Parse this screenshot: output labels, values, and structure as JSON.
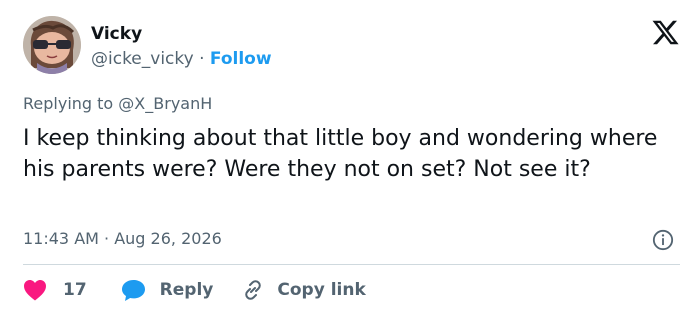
{
  "author": {
    "display_name": "Vicky",
    "handle": "@icke_vicky",
    "separator": " · ",
    "follow_label": "Follow",
    "avatar_icon": "avatar-cartoon-girl"
  },
  "platform_icon": "x-logo-icon",
  "reply_context": {
    "prefix": "Replying to ",
    "target": "@X_BryanH"
  },
  "tweet": {
    "text": "I keep thinking about that little boy and wondering where his parents were? Were they not on set? Not see it?",
    "time": "11:43 AM",
    "separator": " · ",
    "date": "Aug 26, 2026"
  },
  "actions": {
    "like_count": "17",
    "reply_label": "Reply",
    "copy_label": "Copy link"
  },
  "colors": {
    "accent": "#1d9bf0",
    "like": "#f91880",
    "text_primary": "#0f1419",
    "text_secondary": "#536471",
    "divider": "#cfd9de"
  }
}
